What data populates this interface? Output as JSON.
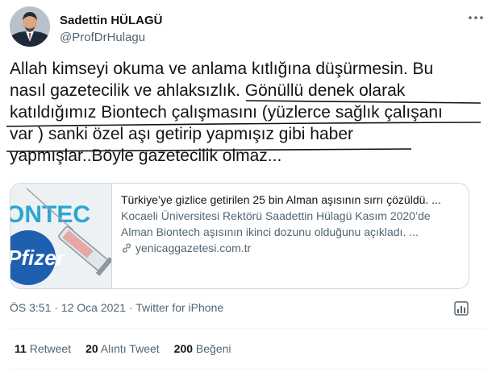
{
  "author": {
    "name": "Sadettin HÜLAGÜ",
    "handle": "@ProfDrHulagu",
    "avatar_icon": "avatar-photo"
  },
  "tweet": {
    "lines": [
      "Allah kimseyi okuma ve anlama kıtlığına düşürmesin. Bu",
      "nasıl gazetecilik ve ahlaksızlık. Gönüllü denek olarak",
      "katıldığımız Biontech çalışmasını (yüzlerce sağlık çalışanı",
      "var ) sanki özel aşı getirip yapmışız gibi haber",
      "yapmışlar..Böyle gazetecilik olmaz..."
    ]
  },
  "card": {
    "title": "Türkiye’ye gizlice getirilen 25 bin Alman aşısının sırrı çözüldü. ...",
    "description_line1": "Kocaeli Üniversitesi Rektörü Saadettin Hülagü Kasım 2020’de",
    "description_line2": "Alman Biontech aşısının ikinci dozunu olduğunu açıkladı. ...",
    "domain": "yenicaggazetesi.com.tr",
    "image_text_top": "ONTEC",
    "image_text_bottom": "Pfizer"
  },
  "meta": {
    "time": "ÖS 3:51",
    "separator": "·",
    "date": "12 Oca 2021",
    "app": "Twitter for iPhone"
  },
  "stats": {
    "retweets_count": "11",
    "retweets_label": "Retweet",
    "quotes_count": "20",
    "quotes_label": "Alıntı Tweet",
    "likes_count": "200",
    "likes_label": "Beğeni"
  },
  "colors": {
    "text": "#0f1419",
    "secondary": "#536471",
    "border": "#cfd9de",
    "pen": "#111111"
  }
}
